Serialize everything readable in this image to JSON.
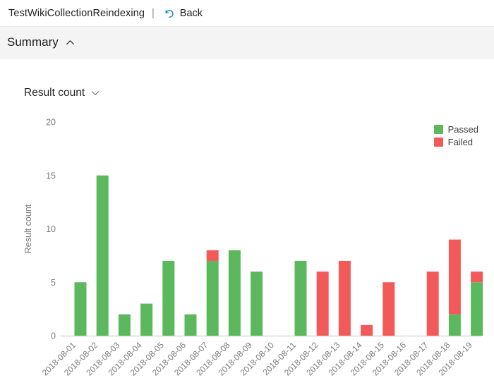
{
  "topbar": {
    "title": "TestWikiCollectionReindexing",
    "separator": "|",
    "back_label": "Back",
    "back_icon": "undo-arrow-icon",
    "back_icon_color": "#0078d4"
  },
  "summary": {
    "title": "Summary",
    "chevron_icon": "chevron-up-icon",
    "expanded": true,
    "background": "#f4f4f4"
  },
  "metric_selector": {
    "label": "Result count",
    "chevron_icon": "chevron-down-icon"
  },
  "legend": {
    "position": "top-right",
    "items": [
      {
        "label": "Passed",
        "color": "#5cb85c"
      },
      {
        "label": "Failed",
        "color": "#f25a5a"
      }
    ]
  },
  "chart_data": {
    "type": "bar",
    "stacked": true,
    "title": "",
    "subtitle": "",
    "xlabel": "",
    "ylabel": "Result count",
    "ylim": [
      0,
      20
    ],
    "yticks": [
      0,
      5,
      10,
      15,
      20
    ],
    "ytick_labels": [
      "0",
      "5",
      "10",
      "15",
      "20"
    ],
    "grid": false,
    "xtick_rotation": -45,
    "categories": [
      "2018-08-01",
      "2018-08-02",
      "2018-08-03",
      "2018-08-04",
      "2018-08-05",
      "2018-08-06",
      "2018-08-07",
      "2018-08-08",
      "2018-08-09",
      "2018-08-10",
      "2018-08-11",
      "2018-08-12",
      "2018-08-13",
      "2018-08-14",
      "2018-08-15",
      "2018-08-16",
      "2018-08-17",
      "2018-08-18",
      "2018-08-19"
    ],
    "series": [
      {
        "name": "Passed",
        "color": "#5cb85c",
        "values": [
          5,
          15,
          2,
          3,
          7,
          2,
          7,
          8,
          6,
          0,
          7,
          0,
          0,
          0,
          0,
          0,
          0,
          2,
          5
        ]
      },
      {
        "name": "Failed",
        "color": "#f25a5a",
        "values": [
          0,
          0,
          0,
          0,
          0,
          0,
          1,
          0,
          0,
          0,
          0,
          6,
          7,
          1,
          5,
          0,
          6,
          7,
          1
        ]
      }
    ],
    "totals": [
      5,
      15,
      2,
      3,
      7,
      2,
      8,
      8,
      6,
      0,
      7,
      6,
      7,
      1,
      5,
      0,
      6,
      9,
      6
    ]
  }
}
